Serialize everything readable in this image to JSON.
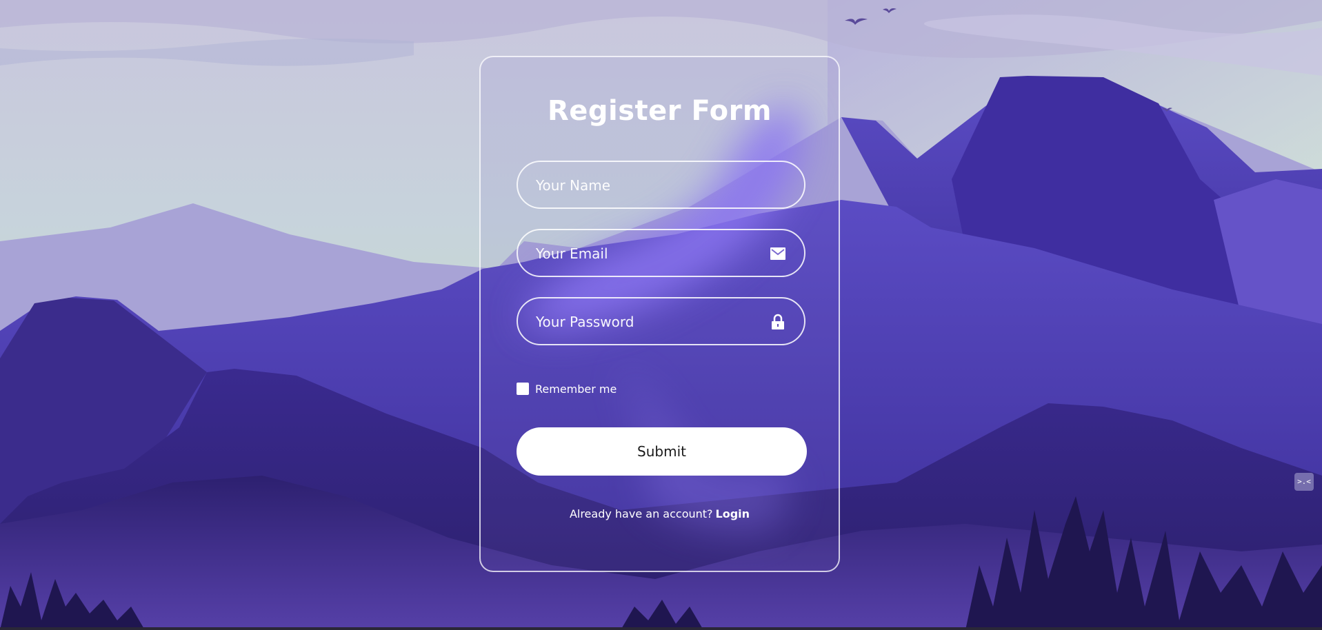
{
  "form": {
    "title": "Register Form",
    "name_placeholder": "Your Name",
    "email_placeholder": "Your Email",
    "password_placeholder": "Your Password",
    "remember_label": "Remember me",
    "remember_checked": false,
    "submit_label": "Submit",
    "login_prompt": "Already have an account?",
    "login_link": "Login"
  },
  "icons": {
    "email": "envelope-icon",
    "password": "lock-icon",
    "side_widget": "collapse-icon"
  },
  "side_widget_label": ">.<",
  "colors": {
    "accent": "#5b3fc4",
    "card_border": "#ffffff",
    "button_bg": "#ffffff",
    "button_text": "#1a1a1a"
  }
}
